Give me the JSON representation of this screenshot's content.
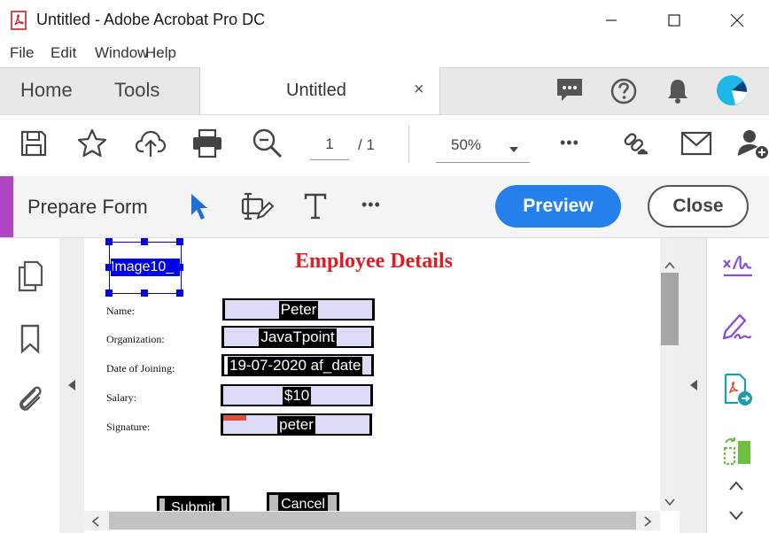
{
  "window": {
    "title": "Untitled - Adobe Acrobat Pro DC"
  },
  "menu": [
    "File",
    "Edit",
    "Window",
    "Help"
  ],
  "tabs": {
    "home": "Home",
    "tools": "Tools",
    "doc": "Untitled",
    "close_glyph": "×"
  },
  "toolbar": {
    "page_current": "1",
    "page_sep": "/ 1",
    "zoom": "50%",
    "more": "•••"
  },
  "formbar": {
    "title": "Prepare Form",
    "more": "•••",
    "preview": "Preview",
    "close": "Close"
  },
  "document": {
    "heading": "Employee Details",
    "image_field": "Image10_",
    "labels": [
      "Name:",
      "Organization:",
      "Date of Joining:",
      "Salary:",
      "Signature:"
    ],
    "fields": [
      "Peter",
      "JavaTpoint",
      "19-07-2020  af_date",
      "$10",
      "peter"
    ],
    "buttons": [
      "Submit",
      "Cancel"
    ]
  },
  "colors": {
    "accent": "#b146c2",
    "preview": "#2680eb",
    "heading": "#e11b22",
    "handle": "#0000e6"
  }
}
